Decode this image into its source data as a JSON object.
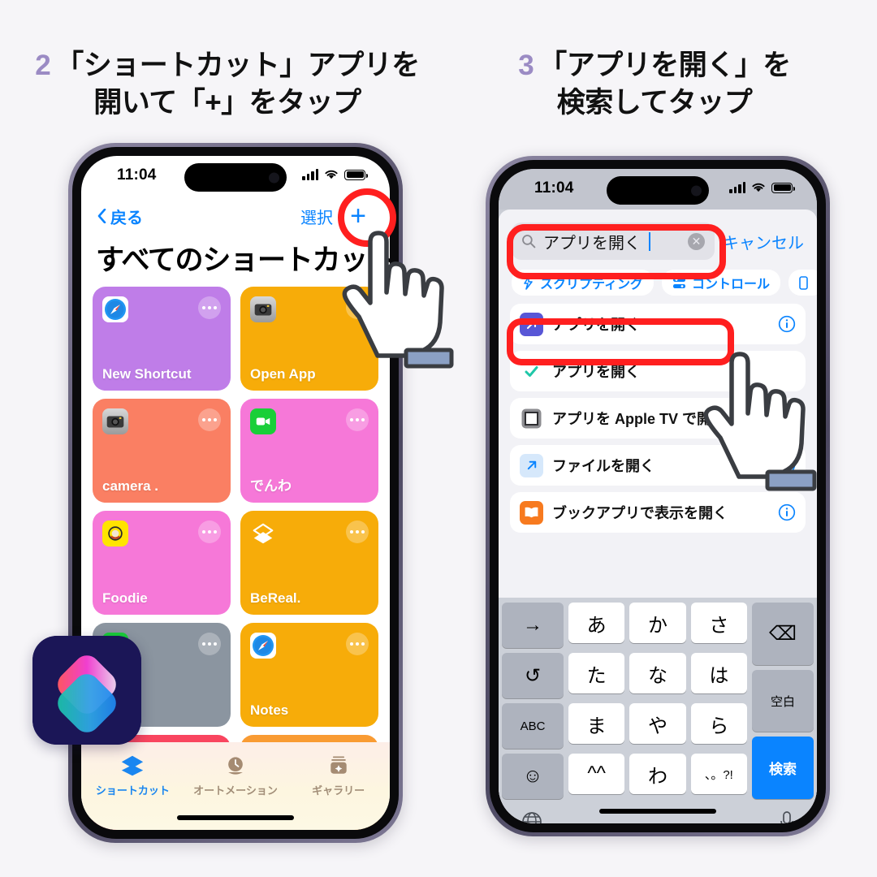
{
  "headings": [
    {
      "num": "2",
      "line1": "「ショートカット」アプリを",
      "line2": "開いて「+」をタップ"
    },
    {
      "num": "3",
      "line1": "「アプリを開く」を",
      "line2": "検索してタップ"
    }
  ],
  "accent_color": "#9b8bc4",
  "highlight_color": "#ff1f1f",
  "ios_blue": "#0a84ff",
  "background_color": "#f6f5f8",
  "left_phone": {
    "status": {
      "time": "11:04",
      "signal": "cellular-bars",
      "wifi": "wifi-icon",
      "battery": "battery-icon"
    },
    "nav": {
      "back_label": "戻る",
      "select_label": "選択",
      "add_label": "+"
    },
    "title": "すべてのショートカット",
    "shortcuts": [
      {
        "label": "New Shortcut",
        "color": "#bf7de8",
        "icon": "safari-icon"
      },
      {
        "label": "Open App",
        "color": "#f7ac09",
        "icon": "camera-icon"
      },
      {
        "label": "camera .",
        "color": "#fa7f63",
        "icon": "camera-icon"
      },
      {
        "label": "でんわ",
        "color": "#f678d8",
        "icon": "facetime-icon"
      },
      {
        "label": "Foodie",
        "color": "#f678d8",
        "icon": "foodie-icon"
      },
      {
        "label": "BeReal.",
        "color": "#f7ac09",
        "icon": "shortcuts-layers-icon"
      },
      {
        "label": "",
        "color": "#8b95a0",
        "icon": "phone-icon"
      },
      {
        "label": "Notes",
        "color": "#f7ac09",
        "icon": "safari-icon"
      },
      {
        "label": "",
        "color": "#f9455f",
        "icon": ""
      },
      {
        "label": "",
        "color": "#f99b33",
        "icon": "kindle-icon"
      }
    ],
    "tabs": [
      {
        "label": "ショートカット",
        "icon": "layers-icon",
        "active": true
      },
      {
        "label": "オートメーション",
        "icon": "clock-icon",
        "active": false
      },
      {
        "label": "ギャラリー",
        "icon": "gallery-icon",
        "active": false
      }
    ]
  },
  "right_phone": {
    "status": {
      "time": "11:04",
      "signal": "cellular-bars",
      "wifi": "wifi-icon",
      "battery": "battery-icon"
    },
    "search": {
      "query": "アプリを開く",
      "icon": "search-icon",
      "clear_label": "✕",
      "cancel_label": "キャンセル"
    },
    "chips": [
      {
        "label": "スクリプティング",
        "icon": "scripting-icon"
      },
      {
        "label": "コントロール",
        "icon": "controls-icon"
      },
      {
        "label": "",
        "icon": "device-icon"
      }
    ],
    "results": [
      {
        "text": "アプリを開く",
        "dim_prefix": "",
        "icon": "open-app-arrow-icon",
        "icon_bg": "#5856d6",
        "info": true,
        "highlighted": true
      },
      {
        "text": "アプリを開く",
        "dim_prefix": "",
        "icon": "check-icon",
        "icon_bg": "#ffffff",
        "info": false,
        "highlighted": false
      },
      {
        "text": "アプリを Apple TV で開く",
        "dim_prefix": "",
        "icon": "appletv-frame-icon",
        "icon_bg": "#ffffff",
        "info": false,
        "highlighted": false
      },
      {
        "text": "ファイルを開く",
        "dim_prefix": "ファイル",
        "icon": "files-arrow-icon",
        "icon_bg": "#d6e8fb",
        "info": true,
        "highlighted": false
      },
      {
        "text": "ブックアプリで表示を開く",
        "dim_prefix": "ブック",
        "icon": "books-icon",
        "icon_bg": "#f77a1f",
        "info": true,
        "highlighted": false
      }
    ],
    "keyboard": {
      "rows": [
        [
          "→",
          "あ",
          "か",
          "さ",
          "⌫"
        ],
        [
          "↺",
          "た",
          "な",
          "は",
          "空白"
        ],
        [
          "ABC",
          "ま",
          "や",
          "ら",
          "検索"
        ],
        [
          "☺",
          "^^",
          "わ",
          "、。?!"
        ]
      ],
      "globe_icon": "globe-icon",
      "mic_icon": "microphone-icon"
    }
  },
  "overlay_logo": {
    "name": "shortcuts-app-icon"
  }
}
